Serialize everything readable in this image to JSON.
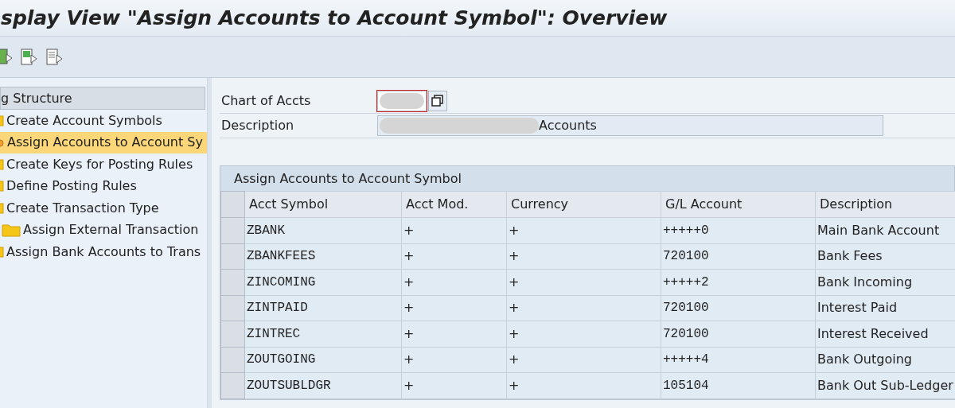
{
  "window": {
    "title": "splay View \"Assign Accounts to Account Symbol\": Overview"
  },
  "tree": {
    "title": "g Structure",
    "items": [
      {
        "label": "Create Account Symbols",
        "selected": false
      },
      {
        "label": "Assign Accounts to Account Sy",
        "selected": true
      },
      {
        "label": "Create Keys for Posting Rules",
        "selected": false
      },
      {
        "label": "Define Posting Rules",
        "selected": false
      },
      {
        "label": "Create Transaction Type",
        "selected": false,
        "children": [
          {
            "label": "Assign External Transaction",
            "selected": false
          }
        ]
      },
      {
        "label": "Assign Bank Accounts to Trans",
        "selected": false
      }
    ]
  },
  "fields": [
    {
      "label": "Chart of Accts",
      "redacted": true,
      "kind": "short"
    },
    {
      "label": "Description",
      "value": "Accounts",
      "redacted": true,
      "kind": "long"
    }
  ],
  "table": {
    "title": "Assign Accounts to Account Symbol",
    "columns": [
      "Acct Symbol",
      "Acct Mod.",
      "Currency",
      "G/L Account",
      "Description"
    ],
    "rows": [
      [
        "ZBANK",
        "+",
        "+",
        "+++++0",
        "Main Bank Account"
      ],
      [
        "ZBANKFEES",
        "+",
        "+",
        "720100",
        "Bank Fees"
      ],
      [
        "ZINCOMING",
        "+",
        "+",
        "+++++2",
        "Bank Incoming"
      ],
      [
        "ZINTPAID",
        "+",
        "+",
        "720100",
        "Interest Paid"
      ],
      [
        "ZINTREC",
        "+",
        "+",
        "720100",
        "Interest Received"
      ],
      [
        "ZOUTGOING",
        "+",
        "+",
        "+++++4",
        "Bank Outgoing"
      ],
      [
        "ZOUTSUBLDGR",
        "+",
        "+",
        "105104",
        "Bank Out Sub-Ledger"
      ]
    ]
  }
}
